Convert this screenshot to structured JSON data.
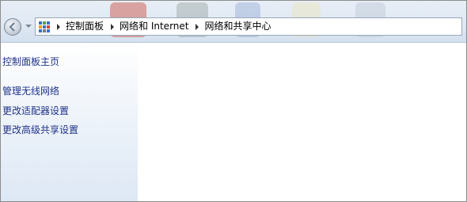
{
  "breadcrumb": {
    "icon": "control-panel-icon",
    "items": [
      "控制面板",
      "网络和 Internet",
      "网络和共享中心"
    ]
  },
  "left_nav": {
    "home_link": "控制面板主页",
    "tasks": [
      "管理无线网络",
      "更改适配器设置",
      "更改高级共享设置"
    ]
  },
  "colors": {
    "link": "#1e3287",
    "topbar": "#dfe8f3",
    "pane_gradient_end": "#dde8f5"
  }
}
